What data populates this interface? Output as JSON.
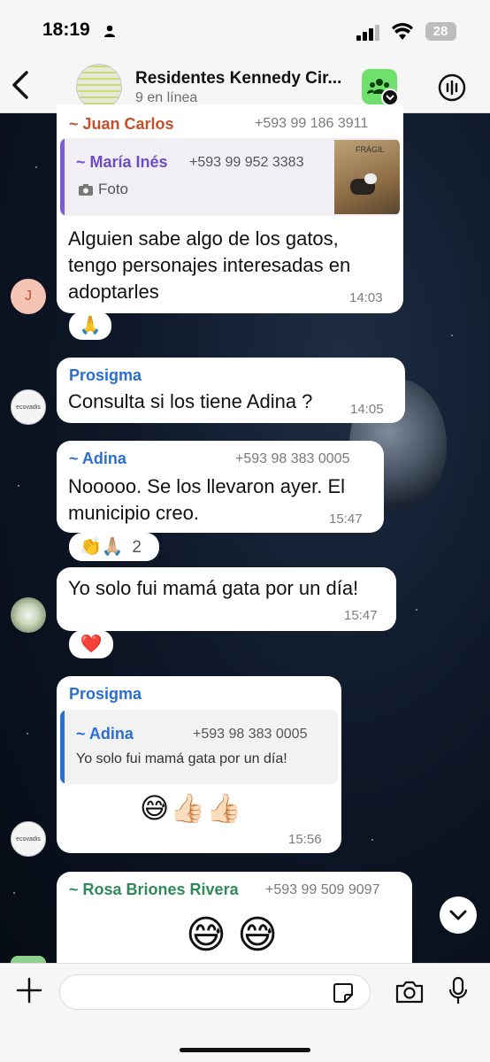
{
  "status_bar": {
    "time": "18:19",
    "battery": "28"
  },
  "header": {
    "title": "Residentes Kennedy Cir...",
    "subtitle": "9 en línea"
  },
  "colors": {
    "juan_carlos": "#c0522e",
    "maria_ines": "#6d4cc6",
    "prosigma": "#2a6fcf",
    "adina": "#2a6fcf",
    "rosa": "#2e8b57",
    "quote_bar_purple": "#7b5cd6",
    "quote_bar_blue": "#2a6fcf"
  },
  "messages": [
    {
      "sender": "~ Juan Carlos",
      "phone": "+593 99 186 3911",
      "quote": {
        "sender": "~ María Inés",
        "phone": "+593 99 952 3383",
        "text": "Foto",
        "image_label": "FRÁGIL"
      },
      "text_lines": [
        "Alguien sabe algo de los gatos,",
        "tengo personajes interesadas en",
        "adoptarles"
      ],
      "time": "14:03",
      "avatar_initial": "J",
      "reaction": "🙏"
    },
    {
      "sender": "Prosigma",
      "text_lines": [
        "Consulta si los tiene Adina ?"
      ],
      "time": "14:05",
      "avatar_text": "ecovadis"
    },
    {
      "sender": "~ Adina",
      "phone": "+593 98 383 0005",
      "text_lines": [
        "Nooooo. Se los llevaron ayer. El",
        "municipio creo."
      ],
      "time": "15:47",
      "reaction": "👏🙏🏼",
      "reaction_count": "2"
    },
    {
      "text_lines": [
        "Yo solo fui mamá gata por un día!"
      ],
      "time": "15:47",
      "reaction": "❤️"
    },
    {
      "sender": "Prosigma",
      "quote": {
        "sender": "~ Adina",
        "phone": "+593 98 383 0005",
        "text": "Yo solo fui mamá gata por un día!"
      },
      "text_lines": [
        "😅👍🏻👍🏻"
      ],
      "time": "15:56",
      "avatar_text": "ecovadis"
    },
    {
      "sender": "~ Rosa Briones Rivera",
      "phone": "+593 99 509 9097",
      "text_lines": [
        "😅 😅"
      ]
    }
  ],
  "composer": {
    "placeholder": ""
  }
}
